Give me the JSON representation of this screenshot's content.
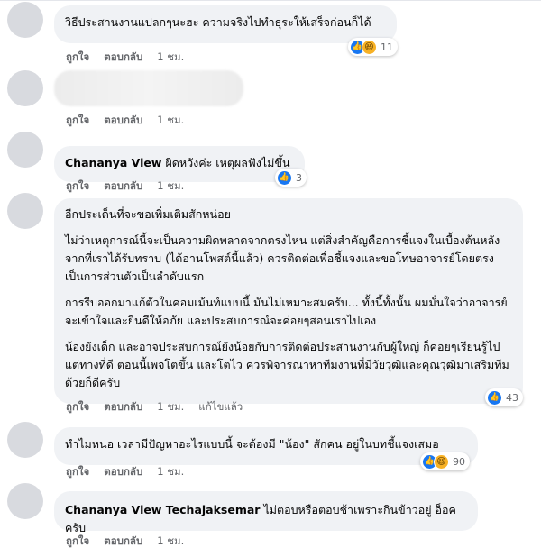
{
  "comments": [
    {
      "text": "วิธีประสานงานแปลกๆนะฮะ ความจริงไปทำธุระให้เสร็จก่อนก็ได้",
      "actions": {
        "like": "ถูกใจ",
        "reply": "ตอบกลับ",
        "time": "1 ชม."
      },
      "reactions": {
        "icons": [
          "like-icon",
          "haha-icon"
        ],
        "count": "11"
      }
    },
    {
      "blurred": true,
      "actions": {
        "like": "ถูกใจ",
        "reply": "ตอบกลับ",
        "time": "1 ชม."
      }
    },
    {
      "author": "Chananya View",
      "text": "ผิดหวังค่ะ เหตุผลฟังไม่ขึ้น",
      "actions": {
        "like": "ถูกใจ",
        "reply": "ตอบกลับ",
        "time": "1 ชม."
      },
      "reactions": {
        "icons": [
          "like-icon"
        ],
        "count": "3"
      }
    },
    {
      "paragraphs": [
        "อีกประเด็นที่จะขอเพิ่มเติมสักหน่อย",
        "ไม่ว่าเหตุการณ์นี้จะเป็นความผิดพลาดจากตรงไหน แต่สิ่งสำคัญคือการชี้แจงในเบื้องต้นหลังจากที่เราได้รับทราบ (ได้อ่านโพสต์นี้แล้ว) ควรติดต่อเพื่อชี้แจงและขอโทษอาจารย์โดยตรงเป็นการส่วนตัวเป็นลำดับแรก",
        "การรีบออกมาแก้ตัวในคอมเม้นท์แบบนี้ มันไม่เหมาะสมครับ... ทั้งนี้ทั้งนั้น ผมมั่นใจว่าอาจารย์จะเข้าใจและยินดีให้อภัย และประสบการณ์จะค่อยๆสอนเราไปเอง",
        "น้องยังเด็ก และอาจประสบการณ์ยังน้อยกับการติดต่อประสานงานกับผู้ใหญ่ ก็ค่อยๆเรียนรู้ไป แต่ทางที่ดี ตอนนี้เพจโตขึ้น และโตไว ควรพิจารณาหาทีมงานที่มีวัยวุฒิและคุณวุฒิมาเสริมทีมด้วยก็ดีครับ"
      ],
      "actions": {
        "like": "ถูกใจ",
        "reply": "ตอบกลับ",
        "time": "1 ชม.",
        "edited": "แก้ไขแล้ว"
      },
      "reactions": {
        "icons": [
          "like-icon"
        ],
        "count": "43"
      }
    },
    {
      "text": "ทำไมหนอ เวลามีปัญหาอะไรแบบนี้ จะต้องมี \"น้อง\" สักคน อยู่ในบทชี้แจงเสมอ",
      "actions": {
        "like": "ถูกใจ",
        "reply": "ตอบกลับ",
        "time": "1 ชม."
      },
      "reactions": {
        "icons": [
          "like-icon",
          "haha-icon"
        ],
        "count": "90"
      }
    },
    {
      "author": "Chananya View Techajaksemar",
      "text": "ไม่ตอบหรือตอบช้าเพราะกินข้าวอยู่ อ็อคครับ",
      "actions": {
        "like": "ถูกใจ",
        "reply": "ตอบกลับ",
        "time": "1 ชม."
      }
    }
  ]
}
